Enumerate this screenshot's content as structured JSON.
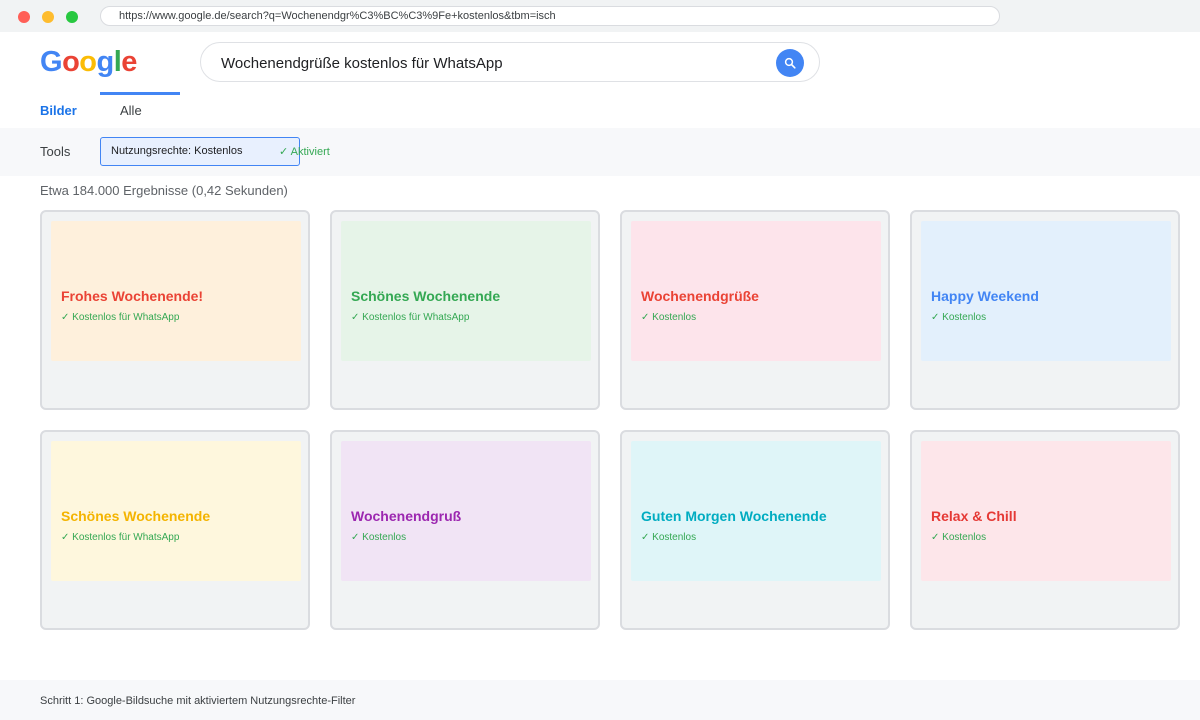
{
  "browser": {
    "url": "https://www.google.de/search?q=Wochenendgr%C3%BC%C3%9Fe+kostenlos&tbm=isch"
  },
  "logo": {
    "letters": [
      "G",
      "o",
      "o",
      "g",
      "l",
      "e"
    ],
    "colors": [
      "#4285f4",
      "#ea4335",
      "#fbbc05",
      "#4285f4",
      "#34a853",
      "#ea4335"
    ]
  },
  "search": {
    "query": "Wochenendgrüße kostenlos für WhatsApp",
    "button_icon": "search-icon"
  },
  "tabs": {
    "bilder": "Bilder",
    "alle": "Alle"
  },
  "tools": {
    "label": "Tools",
    "filter": "Nutzungsrechte: Kostenlos",
    "status": "✓ Aktiviert"
  },
  "results": {
    "count": "Etwa 184.000 Ergebnisse (0,42 Sekunden)",
    "cards": [
      {
        "title": "Frohes Wochenende!",
        "subtitle": "✓ Kostenlos für WhatsApp",
        "bg": "#fef0dc",
        "color": "#ea4335"
      },
      {
        "title": "Schönes Wochenende",
        "subtitle": "✓ Kostenlos für WhatsApp",
        "bg": "#e6f4e8",
        "color": "#34a853"
      },
      {
        "title": "Wochenendgrüße",
        "subtitle": "✓ Kostenlos",
        "bg": "#fde4eb",
        "color": "#ea4335"
      },
      {
        "title": "Happy Weekend",
        "subtitle": "✓ Kostenlos",
        "bg": "#e3f0fc",
        "color": "#4285f4"
      },
      {
        "title": "Schönes Wochenende",
        "subtitle": "✓ Kostenlos für WhatsApp",
        "bg": "#fef7dd",
        "color": "#f4b400"
      },
      {
        "title": "Wochenendgruß",
        "subtitle": "✓ Kostenlos",
        "bg": "#f1e4f5",
        "color": "#9c27b0"
      },
      {
        "title": "Guten Morgen Wochenende",
        "subtitle": "✓ Kostenlos",
        "bg": "#dff5f8",
        "color": "#00acc1"
      },
      {
        "title": "Relax & Chill",
        "subtitle": "✓ Kostenlos",
        "bg": "#fde6ea",
        "color": "#e53935"
      }
    ]
  },
  "footer": {
    "caption": "Schritt 1: Google-Bildsuche mit aktiviertem Nutzungsrechte-Filter"
  }
}
